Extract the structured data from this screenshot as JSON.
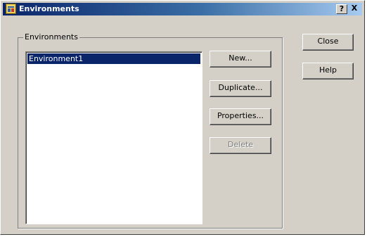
{
  "window": {
    "title": "Environments",
    "help_button": "?",
    "close_button": "X"
  },
  "group": {
    "label": "Environments"
  },
  "environments": {
    "items": [
      "Environment1"
    ],
    "selected": "Environment1"
  },
  "buttons": {
    "new": "New...",
    "duplicate": "Duplicate...",
    "properties": "Properties...",
    "delete": "Delete",
    "close": "Close",
    "help": "Help"
  },
  "colors": {
    "selection": "#0a246a",
    "dialog_face": "#d4d0c8"
  }
}
